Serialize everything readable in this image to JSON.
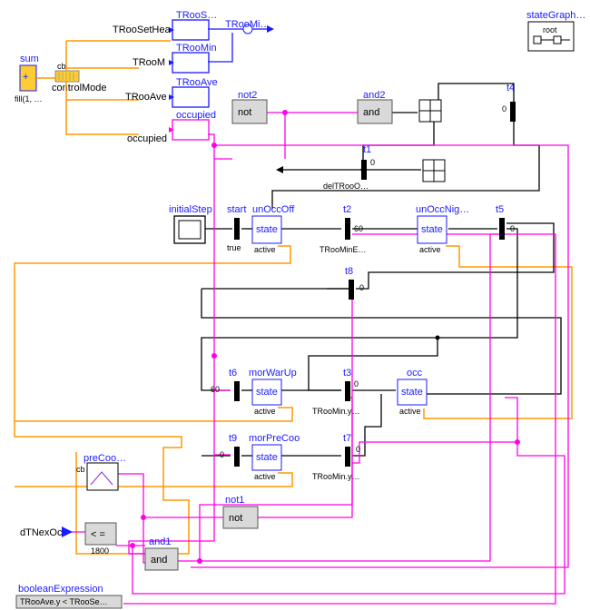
{
  "header": {
    "root_block_label": "stateGraph…",
    "root_text": "root"
  },
  "left": {
    "sum": "sum",
    "fill": "fill(1, …",
    "plus": "+",
    "control_mode": "controlMode",
    "cb": "cb"
  },
  "top_col": {
    "TRooSetHea": "TRooSetHea",
    "TRooM": "TRooM",
    "TRooAve": "TRooAve",
    "occupied": "occupied",
    "TRooS": "TRooS…",
    "TRooMin": "TRooMin",
    "TRooAve2": "TRooAve",
    "TRooMi": "TRooMi…"
  },
  "blocks": {
    "not2_lbl": "not2",
    "not2": "not",
    "and2_lbl": "and2",
    "and2": "and",
    "t4_lbl": "t4",
    "t4_val": "0",
    "t1_lbl": "t1",
    "t1_val": "0",
    "delTRooO": "delTRooO…",
    "initialStep": "initialStep",
    "start_lbl": "start",
    "start_val": "true",
    "unOccOff_lbl": "unOccOff",
    "state": "state",
    "active": "active",
    "t2_lbl": "t2",
    "t2_val": "60",
    "TRooMinE": "TRooMinE…",
    "unOccNig_lbl": "unOccNig…",
    "t5_lbl": "t5",
    "t5_val": "0",
    "t8_lbl": "t8",
    "t8_val": "0",
    "t6_lbl": "t6",
    "t6_val": "60",
    "morWarUp_lbl": "morWarUp",
    "t3_lbl": "t3",
    "t3_val": "0",
    "TRooMin_y": "TRooMin.y…",
    "occ_lbl": "occ",
    "t9_lbl": "t9",
    "t9_val": "0",
    "morPreCoo_lbl": "morPreCoo",
    "t7_lbl": "t7",
    "t7_val": "0",
    "TRooMin_y2": "TRooMin.y…",
    "not1_lbl": "not1",
    "not1": "not",
    "and1_lbl": "and1",
    "and1": "and",
    "preCoo": "preCoo…",
    "dTNexOcc": "dTNexOcc",
    "le": "< =",
    "le_val": "1800",
    "boolExpr": "booleanExpression",
    "boolExpr_val": "TRooAve.y < TRooSe…"
  }
}
